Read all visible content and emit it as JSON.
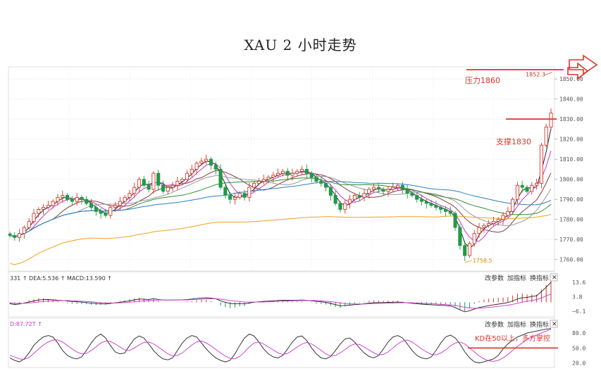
{
  "title": "XAU 2 小时走势",
  "chart_data": [
    {
      "type": "candlestick",
      "title": "XAU 2 小时走势",
      "ylim": [
        1755,
        1856
      ],
      "yticks": [
        1760,
        1770,
        1780,
        1790,
        1800,
        1810,
        1820,
        1830,
        1840,
        1850
      ],
      "ytick_labels": [
        "1760.00",
        "1770.00",
        "1780.00",
        "1790.00",
        "1800.00",
        "1810.00",
        "1820.00",
        "1830.00",
        "1840.00",
        "1850.00"
      ],
      "marks": {
        "high_label": "1852.3",
        "low_label": "1758.5"
      },
      "annotations": {
        "resistance": {
          "text": "压力1860",
          "value": 1860,
          "color": "#d9352b"
        },
        "support": {
          "text": "支撑1830",
          "value": 1830,
          "color": "#d9352b"
        }
      },
      "closes": [
        1772,
        1771,
        1773,
        1776,
        1779,
        1783,
        1785,
        1786,
        1787,
        1789,
        1791,
        1792,
        1790,
        1789,
        1791,
        1790,
        1788,
        1786,
        1784,
        1783,
        1782,
        1786,
        1787,
        1789,
        1791,
        1793,
        1796,
        1800,
        1797,
        1795,
        1803,
        1797,
        1794,
        1796,
        1797,
        1799,
        1800,
        1803,
        1805,
        1808,
        1809,
        1810,
        1807,
        1805,
        1796,
        1792,
        1790,
        1791,
        1793,
        1791,
        1796,
        1798,
        1799,
        1800,
        1801,
        1802,
        1803,
        1804,
        1802,
        1803,
        1804,
        1805,
        1803,
        1801,
        1799,
        1798,
        1796,
        1792,
        1788,
        1785,
        1788,
        1790,
        1792,
        1791,
        1793,
        1795,
        1796,
        1795,
        1794,
        1795,
        1796,
        1797,
        1795,
        1793,
        1792,
        1790,
        1789,
        1788,
        1787,
        1786,
        1785,
        1784,
        1783,
        1776,
        1767,
        1762,
        1768,
        1773,
        1776,
        1777,
        1778,
        1779,
        1780,
        1782,
        1784,
        1790,
        1797,
        1796,
        1794,
        1797,
        1798,
        1817,
        1826,
        1833
      ],
      "ma_series": [
        {
          "color": "#222222"
        },
        {
          "color": "#cc33cc"
        },
        {
          "color": "#8a3a3a"
        },
        {
          "color": "#999999"
        },
        {
          "color": "#2f8f2f"
        },
        {
          "color": "#2a7fc9"
        },
        {
          "color": "#f0a020"
        }
      ]
    },
    {
      "type": "macd",
      "header": "331 ↑ DEA:5.536 ↑ MACD:13.590 ↑",
      "tools": [
        "改参数",
        "加指标",
        "换指标",
        "✕"
      ],
      "ylim": [
        -8,
        16
      ],
      "yticks": [
        13.6,
        3.8,
        -6.1
      ],
      "ytick_labels": [
        "13.6",
        "3.8",
        "−6.1"
      ],
      "diff": [
        -1,
        -1.5,
        -1.2,
        -0.6,
        0.2,
        0.9,
        1.5,
        1.8,
        1.9,
        1.7,
        1.4,
        1.2,
        0.8,
        0.5,
        0.3,
        0.1,
        -0.2,
        -0.6,
        -0.9,
        -1.1,
        -1.2,
        -0.8,
        -0.4,
        0,
        0.5,
        1,
        1.6,
        2.2,
        2.1,
        1.9,
        2.5,
        1.9,
        1.5,
        1.5,
        1.5,
        1.6,
        1.7,
        1.9,
        2.2,
        2.6,
        2.9,
        3.1,
        2.8,
        2.4,
        1,
        0,
        -0.8,
        -1,
        -0.9,
        -1.1,
        -0.5,
        0,
        0.3,
        0.6,
        0.8,
        1,
        1.2,
        1.4,
        1.3,
        1.3,
        1.4,
        1.5,
        1.3,
        1,
        0.6,
        0.3,
        -0.1,
        -0.8,
        -1.6,
        -2.4,
        -2.3,
        -2,
        -1.6,
        -1.4,
        -1,
        -0.6,
        -0.3,
        -0.2,
        -0.2,
        -0.1,
        0,
        0.1,
        -0.1,
        -0.4,
        -0.7,
        -1,
        -1.3,
        -1.5,
        -1.7,
        -1.9,
        -2.1,
        -2.3,
        -2.5,
        -3.6,
        -5.2,
        -6.5,
        -5.8,
        -4.6,
        -3.6,
        -2.9,
        -2.3,
        -1.8,
        -1.3,
        -0.8,
        -0.2,
        0.9,
        2.3,
        3,
        3.3,
        3.9,
        4.4,
        7.2,
        10.3,
        13.6
      ],
      "dea": [
        -0.5,
        -0.7,
        -0.8,
        -0.7,
        -0.5,
        -0.2,
        0.1,
        0.5,
        0.8,
        1,
        1.1,
        1.1,
        1.1,
        1,
        0.9,
        0.7,
        0.5,
        0.3,
        0,
        -0.2,
        -0.4,
        -0.5,
        -0.5,
        -0.4,
        -0.2,
        0,
        0.3,
        0.7,
        0.9,
        1.1,
        1.4,
        1.5,
        1.5,
        1.5,
        1.5,
        1.5,
        1.6,
        1.6,
        1.8,
        1.9,
        2.1,
        2.3,
        2.4,
        2.4,
        2.1,
        1.7,
        1.2,
        0.8,
        0.5,
        0.2,
        0.1,
        0.1,
        0.1,
        0.2,
        0.3,
        0.5,
        0.6,
        0.8,
        0.9,
        1,
        1.1,
        1.2,
        1.2,
        1.2,
        1.1,
        0.9,
        0.7,
        0.4,
        0,
        -0.5,
        -0.9,
        -1.1,
        -1.2,
        -1.2,
        -1.2,
        -1.1,
        -0.9,
        -0.8,
        -0.7,
        -0.6,
        -0.5,
        -0.4,
        -0.3,
        -0.3,
        -0.4,
        -0.5,
        -0.7,
        -0.8,
        -1,
        -1.2,
        -1.4,
        -1.6,
        -1.8,
        -2.2,
        -2.8,
        -3.5,
        -3.9,
        -4.1,
        -4,
        -3.8,
        -3.5,
        -3.2,
        -2.8,
        -2.4,
        -2,
        -1.4,
        -0.7,
        0,
        0.6,
        1.2,
        1.8,
        2.9,
        4.4,
        5.536
      ]
    },
    {
      "type": "kd",
      "header": "D:87.72T ↑",
      "tools": [
        "改参数",
        "加指标",
        "换指标",
        "✕"
      ],
      "ylim": [
        15,
        90
      ],
      "yticks": [
        80,
        50,
        20
      ],
      "ytick_labels": [
        "80.0",
        "50.0",
        "20.0"
      ],
      "annotation": {
        "text": "KD在50以上，多方掌控",
        "value": 50,
        "color": "#d9352b"
      },
      "k": [
        30,
        25,
        22,
        28,
        40,
        55,
        65,
        72,
        75,
        72,
        60,
        45,
        35,
        30,
        28,
        32,
        45,
        60,
        72,
        78,
        70,
        55,
        42,
        38,
        40,
        55,
        68,
        74,
        70,
        58,
        45,
        35,
        28,
        26,
        30,
        45,
        60,
        70,
        75,
        72,
        60,
        48,
        38,
        30,
        25,
        22,
        25,
        38,
        55,
        70,
        78,
        74,
        62,
        48,
        38,
        32,
        30,
        35,
        48,
        62,
        72,
        74,
        65,
        50,
        38,
        30,
        28,
        33,
        45,
        58,
        68,
        70,
        62,
        50,
        40,
        33,
        30,
        35,
        48,
        62,
        72,
        75,
        70,
        58,
        45,
        35,
        30,
        28,
        32,
        45,
        60,
        72,
        76,
        70,
        58,
        42,
        30,
        22,
        20,
        22,
        25,
        28,
        35,
        48,
        58,
        66,
        72,
        76,
        80,
        82,
        84,
        86,
        88,
        89
      ],
      "d": [
        35,
        32,
        28,
        27,
        31,
        39,
        48,
        56,
        62,
        66,
        66,
        62,
        55,
        48,
        42,
        38,
        39,
        45,
        52,
        60,
        64,
        63,
        58,
        52,
        46,
        45,
        50,
        56,
        61,
        62,
        58,
        52,
        45,
        38,
        34,
        35,
        40,
        48,
        56,
        62,
        64,
        60,
        54,
        47,
        40,
        34,
        29,
        28,
        33,
        42,
        52,
        60,
        62,
        58,
        52,
        46,
        40,
        37,
        39,
        45,
        52,
        58,
        61,
        58,
        52,
        45,
        38,
        34,
        35,
        40,
        47,
        54,
        58,
        57,
        52,
        46,
        40,
        36,
        37,
        42,
        50,
        58,
        64,
        66,
        62,
        55,
        48,
        42,
        37,
        36,
        40,
        46,
        54,
        60,
        62,
        58,
        50,
        42,
        34,
        28,
        24,
        23,
        25,
        30,
        37,
        45,
        53,
        60,
        67,
        72,
        76,
        80,
        84,
        87.72
      ]
    }
  ]
}
